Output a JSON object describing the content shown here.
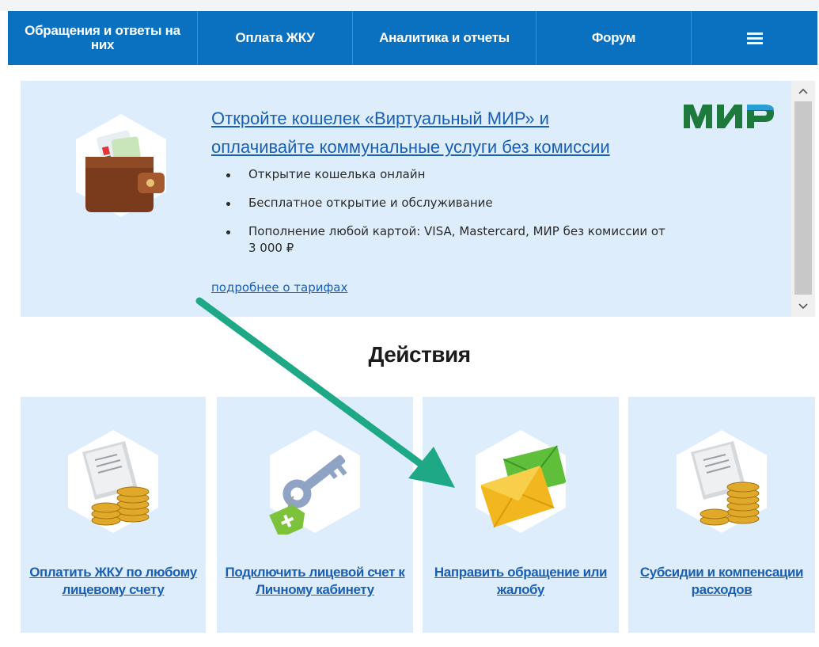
{
  "nav": {
    "items": [
      {
        "label": "Обращения и ответы на них"
      },
      {
        "label": "Оплата ЖКУ"
      },
      {
        "label": "Аналитика и отчеты"
      },
      {
        "label": "Форум"
      }
    ],
    "menu_icon": "hamburger-menu-icon"
  },
  "promo": {
    "title": "Откройте кошелек «Виртуальный МИР» и оплачивайте коммунальные услуги без комиссии",
    "logo_text": "МИР",
    "bullets": [
      "Открытие кошелька онлайн",
      "Бесплатное открытие и обслуживание",
      "Пополнение любой картой: VISA, Mastercard, МИР без комиссии от 3 000 ₽"
    ],
    "link": "подробнее о тарифах",
    "icon": "wallet-icon"
  },
  "actions": {
    "title": "Действия",
    "cards": [
      {
        "label": "Оплатить ЖКУ по любому лицевому счету",
        "icon": "receipt-coins-icon"
      },
      {
        "label": "Подключить лицевой счет к Личному кабинету",
        "icon": "key-tag-icon"
      },
      {
        "label": "Направить обращение или жалобу",
        "icon": "envelope-icon"
      },
      {
        "label": "Субсидии и компенсации расходов",
        "icon": "subsidy-coins-icon"
      }
    ]
  },
  "colors": {
    "nav_bg": "#0a70c0",
    "panel_bg": "#deedfb",
    "link": "#1a5fb4",
    "mir_green": "#1e7a3c",
    "arrow": "#1ea886"
  }
}
